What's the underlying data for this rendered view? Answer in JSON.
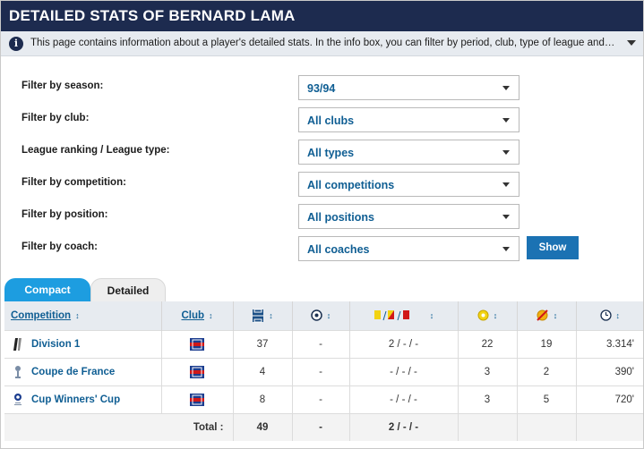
{
  "header": {
    "title": "DETAILED STATS OF BERNARD LAMA"
  },
  "info": {
    "text": "This page contains information about a player's detailed stats. In the info box, you can filter by period, club, type of league and competition. The..."
  },
  "filters": [
    {
      "label": "Filter by season:",
      "value": "93/94"
    },
    {
      "label": "Filter by club:",
      "value": "All clubs"
    },
    {
      "label": "League ranking / League type:",
      "value": "All types"
    },
    {
      "label": "Filter by competition:",
      "value": "All competitions"
    },
    {
      "label": "Filter by position:",
      "value": "All positions"
    },
    {
      "label": "Filter by coach:",
      "value": "All coaches"
    }
  ],
  "show_button": "Show",
  "tabs": {
    "compact": "Compact",
    "detailed": "Detailed"
  },
  "table": {
    "headers": {
      "competition": "Competition",
      "club": "Club"
    },
    "sort_glyph": "↕",
    "rows": [
      {
        "competition": "Division 1",
        "apps": "37",
        "goals": "-",
        "cards": "2 / - / -",
        "subs_in": "22",
        "subs_out": "19",
        "minutes": "3.314'"
      },
      {
        "competition": "Coupe de France",
        "apps": "4",
        "goals": "-",
        "cards": "- / - / -",
        "subs_in": "3",
        "subs_out": "2",
        "minutes": "390'"
      },
      {
        "competition": "Cup Winners' Cup",
        "apps": "8",
        "goals": "-",
        "cards": "- / - / -",
        "subs_in": "3",
        "subs_out": "5",
        "minutes": "720'"
      }
    ],
    "total": {
      "label": "Total :",
      "apps": "49",
      "goals": "-",
      "cards": "2 / - / -"
    }
  },
  "colors": {
    "header_bg": "#1d2b4f",
    "link": "#0f5e93",
    "tab_active": "#1d9de0",
    "button": "#1b72b3",
    "yellow_card": "#f2d313",
    "red_card": "#d01818"
  },
  "icons": [
    "info-icon",
    "chevron-down-icon",
    "pitch-icon",
    "ball-icon",
    "cards-icon",
    "sub-in-icon",
    "sub-out-icon",
    "clock-icon",
    "club-logo",
    "competition-icon"
  ]
}
